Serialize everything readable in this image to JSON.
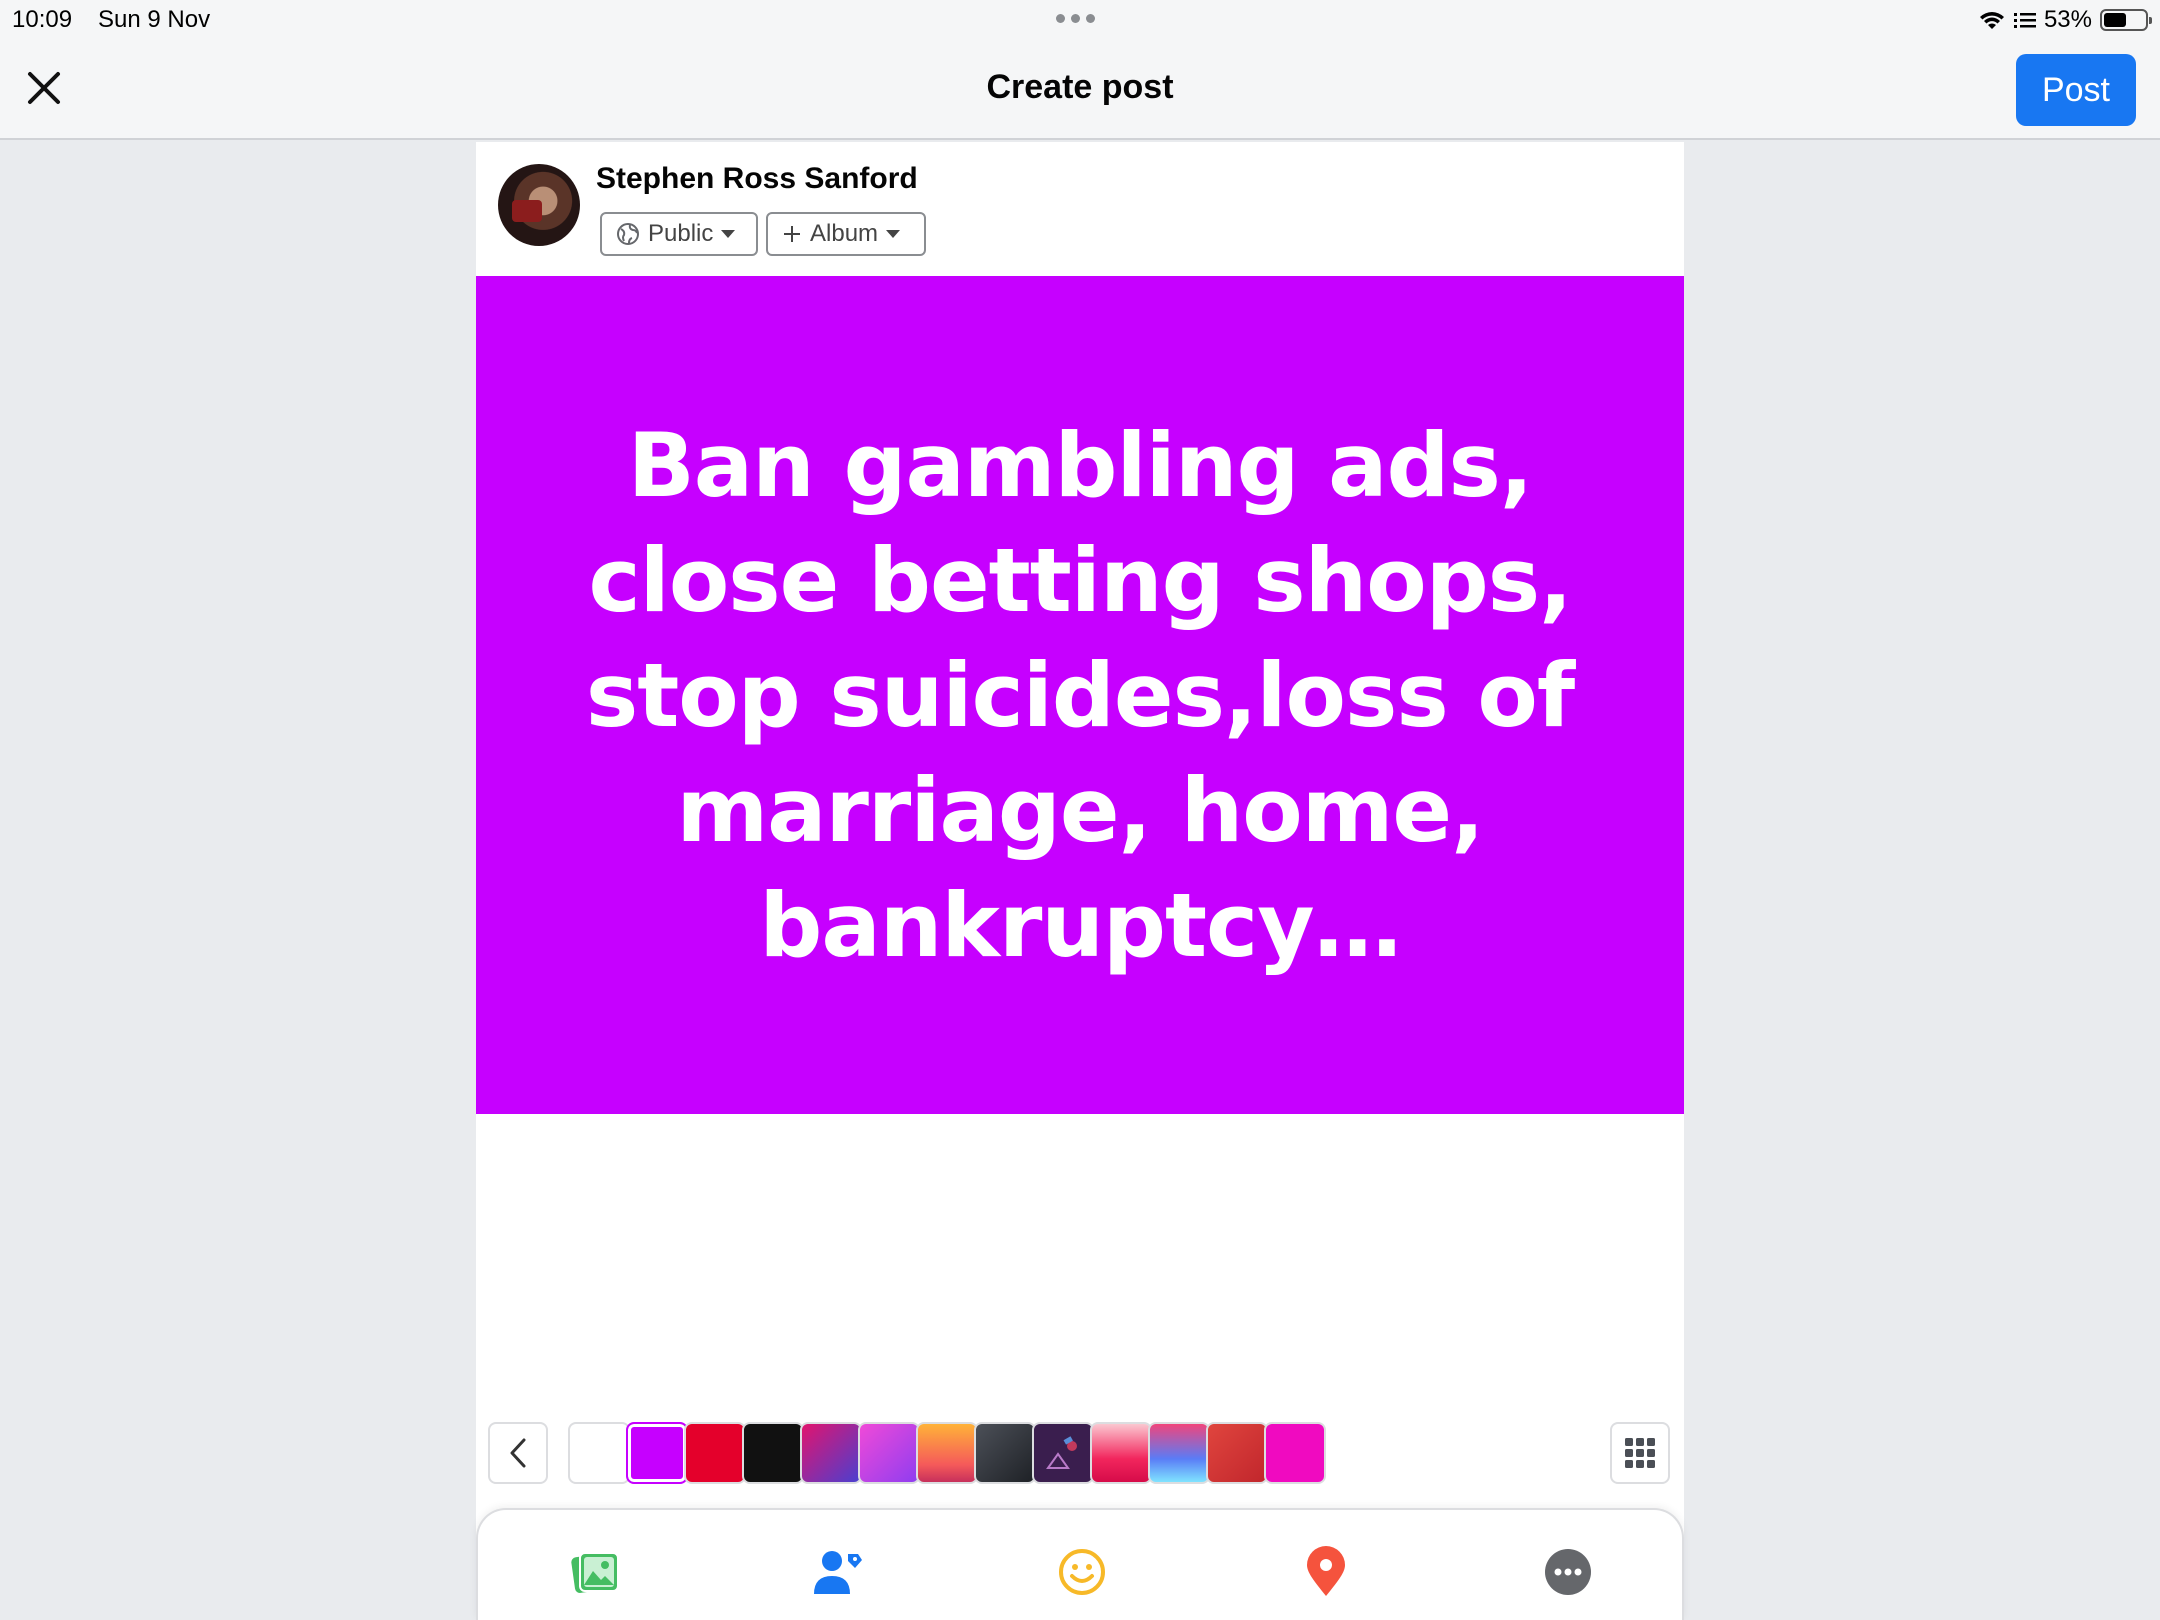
{
  "status_bar": {
    "time": "10:09",
    "date": "Sun 9 Nov",
    "battery": "53%"
  },
  "header": {
    "title": "Create post",
    "post_label": "Post"
  },
  "user": {
    "name": "Stephen Ross Sanford",
    "audience": "Public",
    "album": "Album"
  },
  "post": {
    "text": "Ban gambling ads, close betting shops, stop suicides,loss of marriage, home, bankruptcy…"
  },
  "background_picker": {
    "selected_index": 1,
    "swatches": [
      {
        "name": "white",
        "fill": "#ffffff"
      },
      {
        "name": "purple",
        "fill": "#c600ff"
      },
      {
        "name": "red",
        "fill": "#e4002b"
      },
      {
        "name": "black",
        "fill": "#111111"
      },
      {
        "name": "magenta-blue-gradient",
        "fill": "linear-gradient(135deg,#e1146e,#4a3fd0)"
      },
      {
        "name": "violet-gradient",
        "fill": "linear-gradient(135deg,#f04ad8,#8f3df0)"
      },
      {
        "name": "orange-gradient",
        "fill": "linear-gradient(180deg,#ffb238,#f55a5a 70%,#c7305b)"
      },
      {
        "name": "slate-gradient",
        "fill": "linear-gradient(135deg,#4c5058,#1e2126)"
      },
      {
        "name": "space-illustration",
        "fill": "#3a1e4e"
      },
      {
        "name": "pink-gradient",
        "fill": "linear-gradient(180deg,#fbc7d0,#f2265d 60%,#d60b49)"
      },
      {
        "name": "pink-blue-gradient",
        "fill": "linear-gradient(180deg,#f0457c,#5a7cf6 60%,#7fe3ff)"
      },
      {
        "name": "crimson-gradient",
        "fill": "linear-gradient(135deg,#e0453e,#c1262c)"
      },
      {
        "name": "hot-pink",
        "fill": "#f00ac0"
      }
    ]
  },
  "colors": {
    "accent": "#1877f2",
    "post_background": "#c600ff"
  }
}
